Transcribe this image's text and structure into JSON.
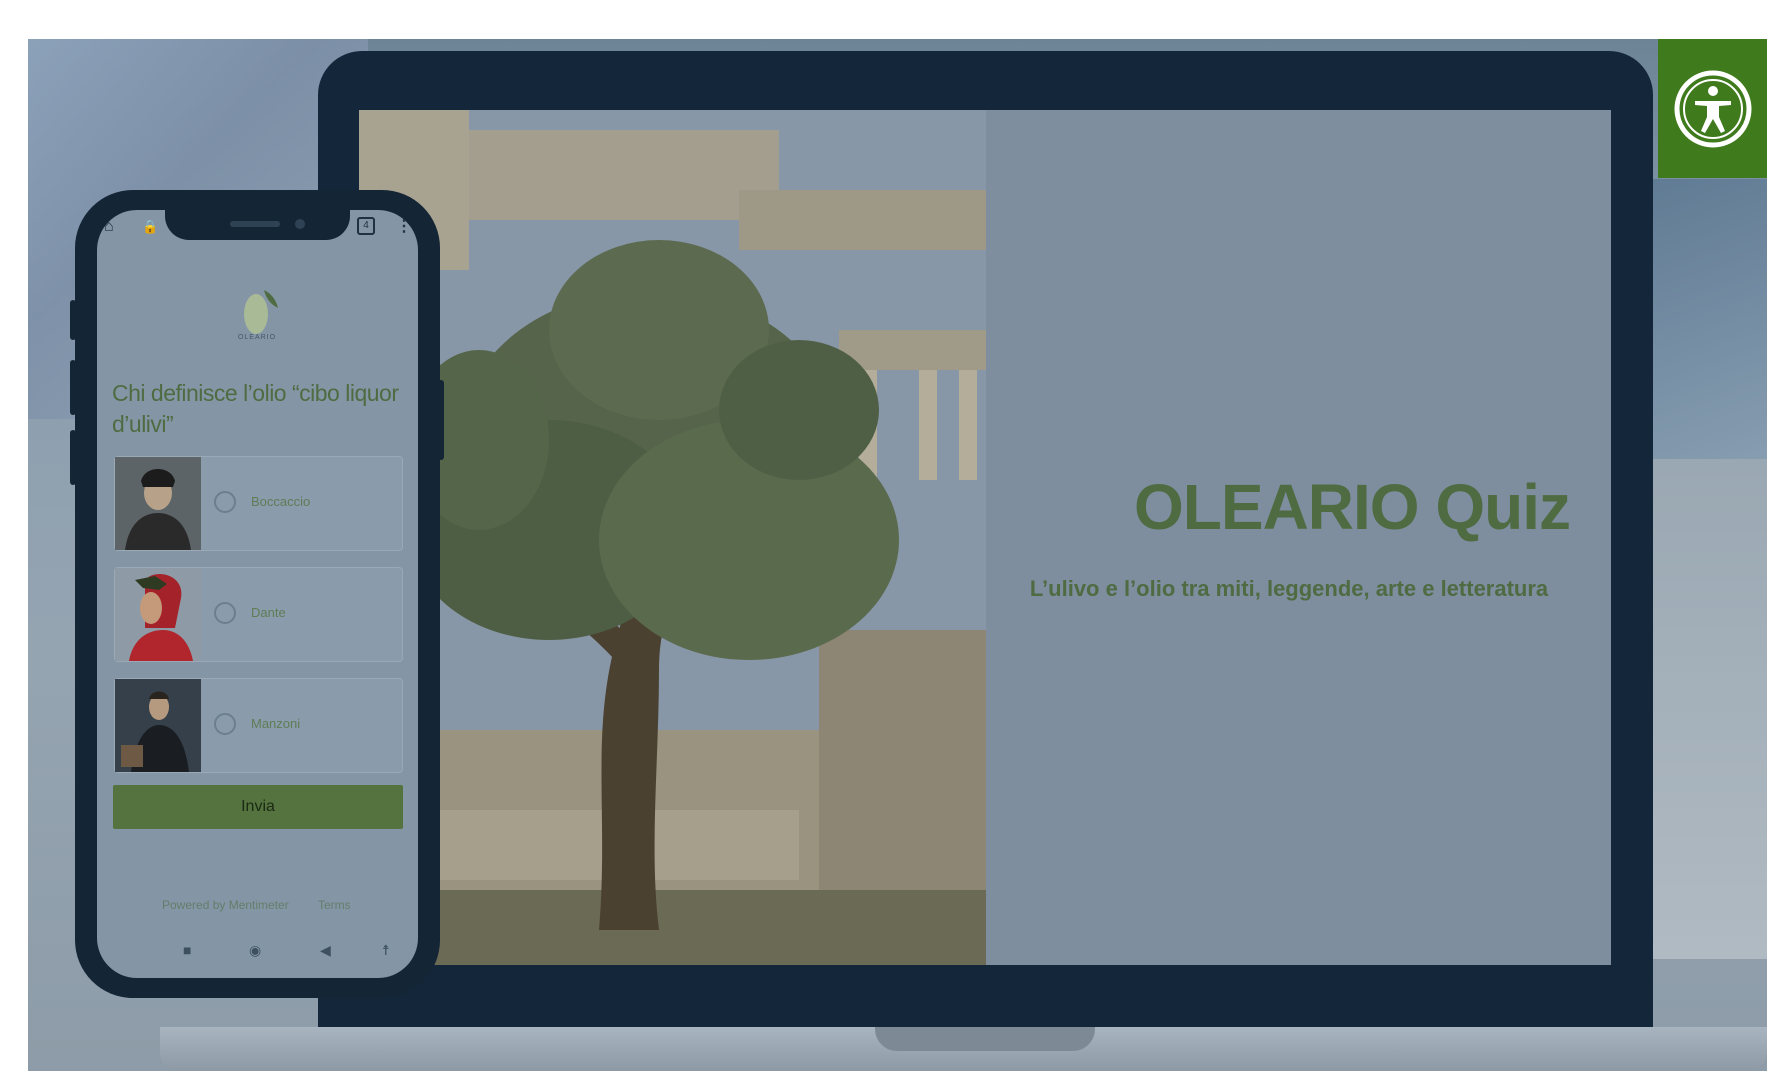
{
  "slide": {
    "title": "OLEARIO Quiz",
    "subtitle": "L’ulivo e l’olio tra miti, leggende, arte e letteratura"
  },
  "phone": {
    "logo_text": "OLEARIO",
    "question": "Chi definisce l’olio “cibo liquor d’ulivi”",
    "options": [
      {
        "label": "Boccaccio"
      },
      {
        "label": "Dante"
      },
      {
        "label": "Manzoni"
      }
    ],
    "submit_label": "Invia",
    "footer": {
      "powered": "Powered by Mentimeter",
      "terms": "Terms"
    },
    "tab_count": "4"
  },
  "colors": {
    "accent_green": "#4f6b42",
    "a11y_green": "#3f7a1d",
    "device_navy": "#13263a"
  },
  "icons": [
    "accessibility-icon",
    "home-icon",
    "lock-icon",
    "tabs-icon",
    "menu-dots-icon",
    "olive-logo-icon",
    "nav-stop-icon",
    "nav-home-icon",
    "nav-back-icon",
    "nav-accessibility-icon"
  ]
}
